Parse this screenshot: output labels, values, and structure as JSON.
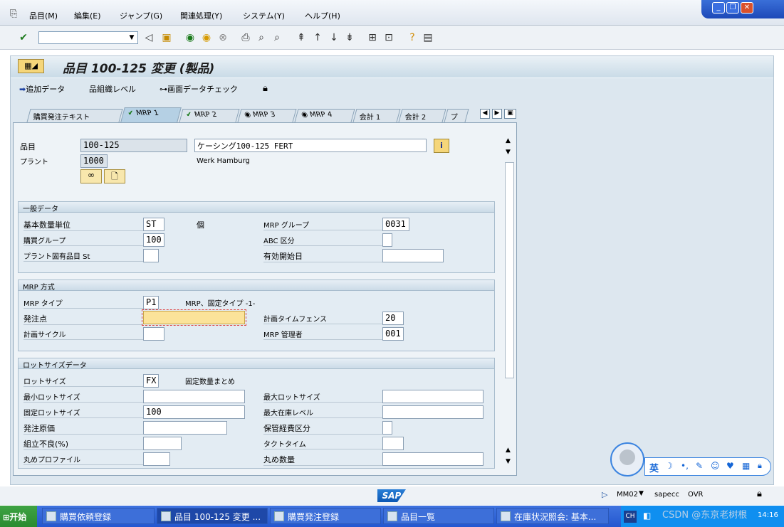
{
  "menubar": {
    "items": [
      "品目(M)",
      "編集(E)",
      "ジャンプ(G)",
      "関連処理(Y)",
      "システム(Y)",
      "ヘルプ(H)"
    ]
  },
  "window": {
    "controls": [
      "_",
      "❐",
      "✕"
    ]
  },
  "screen": {
    "title": "品目 100-125 変更 (製品)"
  },
  "appbar": {
    "additional_data": "追加データ",
    "org_levels": "組織レベル",
    "check_screen": "画面データチェック"
  },
  "tabs": [
    "購買発注テキスト",
    "MRP 1",
    "MRP 2",
    "MRP 3",
    "MRP 4",
    "会計 1",
    "会計 2",
    "プ"
  ],
  "header": {
    "material_label": "品目",
    "material": "100-125",
    "description": "ケーシング100-125 FERT",
    "plant_label": "プラント",
    "plant": "1000",
    "plant_name": "Werk Hamburg"
  },
  "general": {
    "title": "一般データ",
    "base_uom_label": "基本数量単位",
    "base_uom": "ST",
    "base_uom_text": "個",
    "purch_group_label": "購買グループ",
    "purch_group": "100",
    "plant_status_label": "プラント固有品目 St",
    "plant_status": "",
    "mrp_group_label": "MRP グループ",
    "mrp_group": "0031",
    "abc_label": "ABC 区分",
    "abc": "",
    "valid_from_label": "有効開始日",
    "valid_from": ""
  },
  "mrp": {
    "title": "MRP 方式",
    "mrp_type_label": "MRP タイプ",
    "mrp_type": "P1",
    "mrp_type_text": "MRP、固定タイプ -1-",
    "reorder_label": "発注点",
    "reorder": "",
    "cycle_label": "計画サイクル",
    "cycle": "",
    "fence_label": "計画タイムフェンス",
    "fence": "20",
    "controller_label": "MRP 管理者",
    "controller": "001"
  },
  "lot": {
    "title": "ロットサイズデータ",
    "lot_size_label": "ロットサイズ",
    "lot_size": "FX",
    "lot_size_text": "固定数量まとめ",
    "min_label": "最小ロットサイズ",
    "min": "",
    "fixed_label": "固定ロットサイズ",
    "fixed": "100",
    "order_cost_label": "発注原価",
    "order_cost": "",
    "assembly_scrap_label": "組立不良(%)",
    "assembly_scrap": "",
    "rounding_label": "丸めプロファイル",
    "rounding": "",
    "max_label": "最大ロットサイズ",
    "max": "",
    "max_stock_label": "最大在庫レベル",
    "max_stock": "",
    "storage_cost_label": "保管経費区分",
    "storage_cost": "",
    "takt_label": "タクトタイム",
    "takt": "",
    "round_qty_label": "丸め数量",
    "round_qty": ""
  },
  "statusbar": {
    "logo": "SAP",
    "tcode": "MM02",
    "server": "sapecc",
    "mode": "OVR"
  },
  "ime": {
    "lang": "英"
  },
  "taskbar": {
    "start": "开始",
    "tasks": [
      "購買依頼登録",
      "品目 100-125 変更 ...",
      "購買発注登録",
      "品目一覧",
      "在庫状況照会: 基本..."
    ],
    "tray_lang": "CH",
    "clock": "14:16",
    "watermark": "CSDN @东京老树根"
  }
}
